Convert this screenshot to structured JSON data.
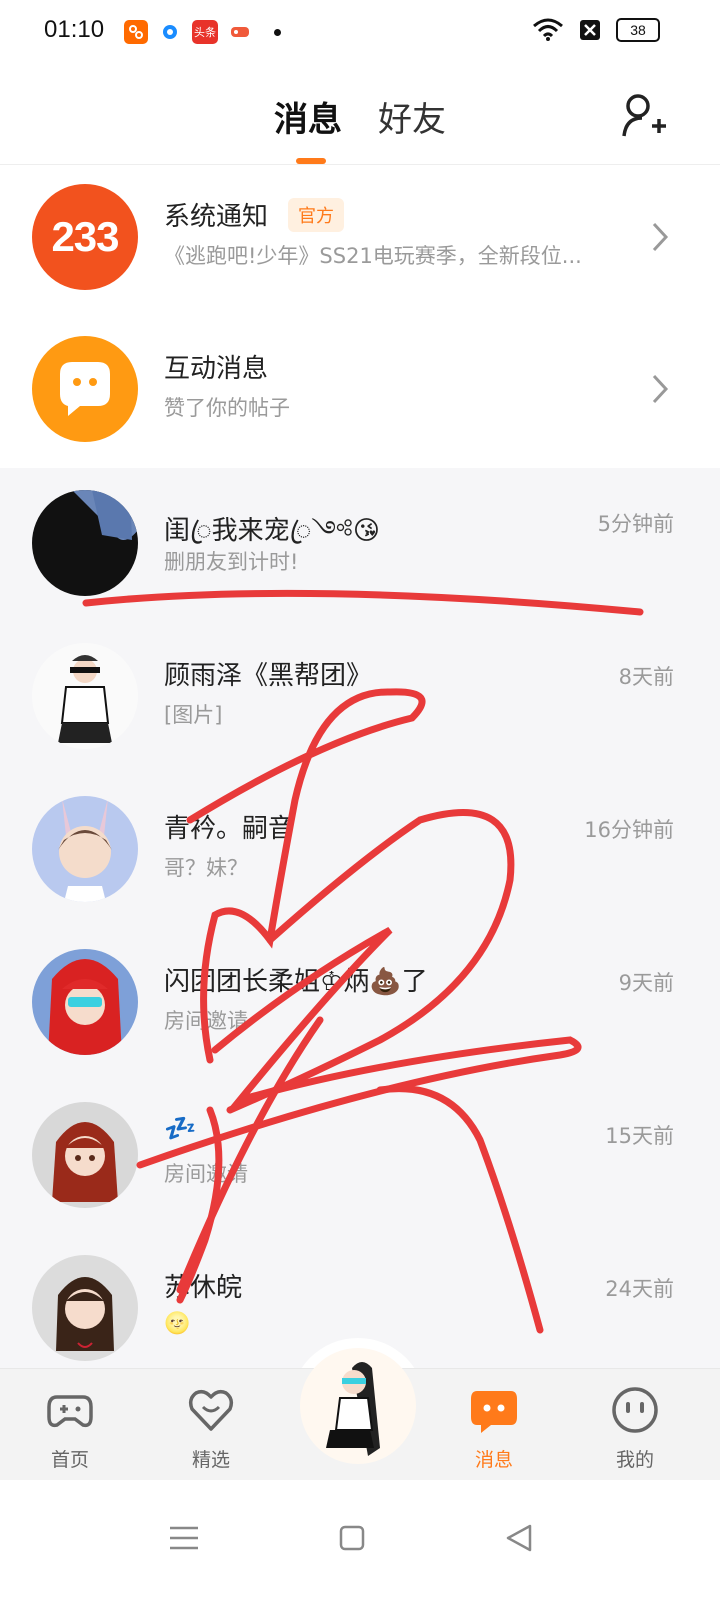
{
  "status_bar": {
    "time": "01:10",
    "battery": "38",
    "app_icons": [
      "app-233-icon",
      "browser-icon",
      "toutiao-icon",
      "game-icon"
    ],
    "toutiao_label": "头条"
  },
  "header": {
    "tabs": [
      {
        "label": "消息",
        "active": true
      },
      {
        "label": "好友",
        "active": false
      }
    ]
  },
  "system_rows": [
    {
      "title": "系统通知",
      "badge": "官方",
      "subtitle": "《逃跑吧!少年》SS21电玩赛季，全新段位...",
      "avatar_text": "233"
    },
    {
      "title": "互动消息",
      "subtitle": "赞了你的帖子"
    }
  ],
  "chats": [
    {
      "name": "闺ꦿ我来宠ꦿ༺😘",
      "preview": "删朋友到计时!",
      "time": "5分钟前"
    },
    {
      "name": "顾雨泽《黑帮团》",
      "preview": "[图片]",
      "time": "8天前"
    },
    {
      "name": "青衿。嗣音",
      "preview": "哥？妹？",
      "time": "16分钟前"
    },
    {
      "name": "闪团团长柔姐♔炳💩了",
      "preview": "房间邀请",
      "time": "9天前"
    },
    {
      "name": "💤",
      "preview": "房间邀请",
      "time": "15天前"
    },
    {
      "name": "苏休皖",
      "preview": "🌝",
      "time": "24天前"
    }
  ],
  "bottom_nav": [
    {
      "label": "首页",
      "active": false
    },
    {
      "label": "精选",
      "active": false
    },
    {
      "label": "消息",
      "active": true
    },
    {
      "label": "我的",
      "active": false
    }
  ],
  "colors": {
    "accent": "#ff7a1a",
    "scribble": "#e83a3a",
    "text_secondary": "#9a9a9a"
  }
}
